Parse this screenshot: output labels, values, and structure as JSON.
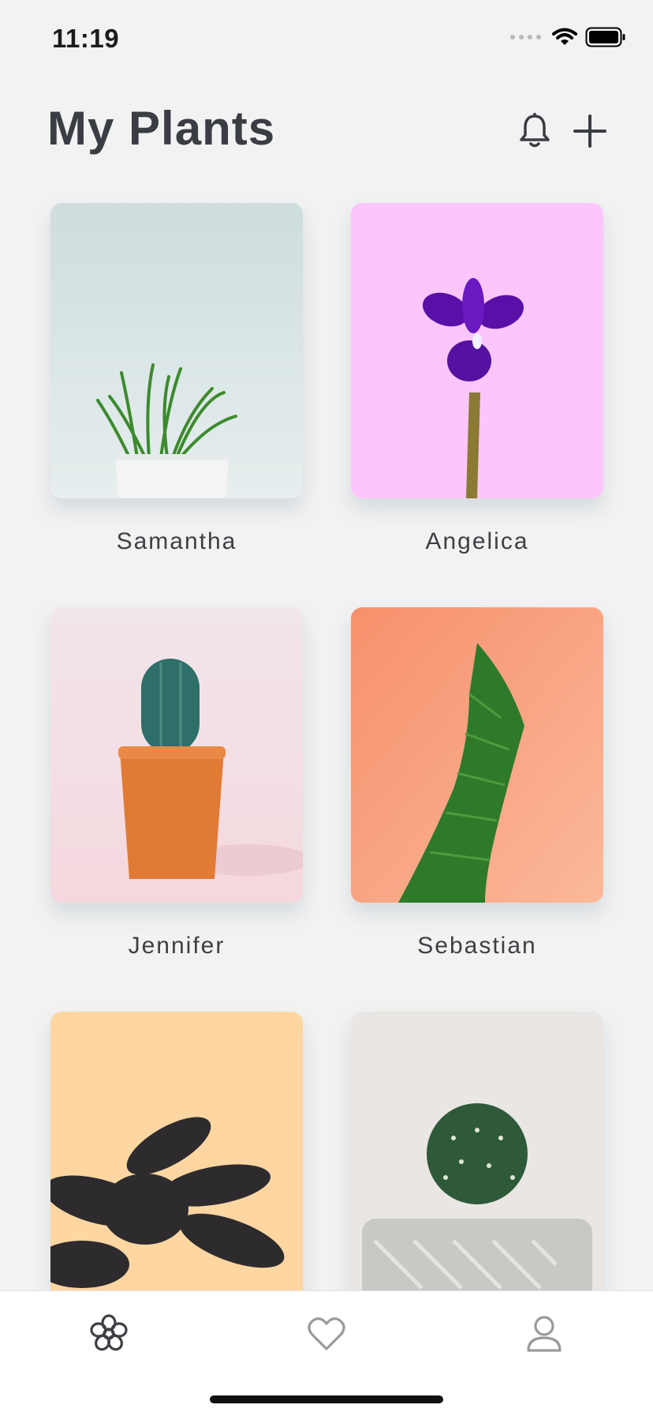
{
  "status_bar": {
    "time": "11:19"
  },
  "header": {
    "title": "My Plants"
  },
  "plants": [
    {
      "name": "Samantha"
    },
    {
      "name": "Angelica"
    },
    {
      "name": "Jennifer"
    },
    {
      "name": "Sebastian"
    },
    {
      "name": ""
    },
    {
      "name": ""
    }
  ],
  "icons": {
    "notifications": "bell-icon",
    "add": "plus-icon",
    "tab_plants": "flower-icon",
    "tab_favorites": "heart-icon",
    "tab_profile": "user-icon"
  },
  "colors": {
    "background": "#f2f2f2",
    "text": "#3d3f44",
    "tabbar": "#ffffff"
  }
}
